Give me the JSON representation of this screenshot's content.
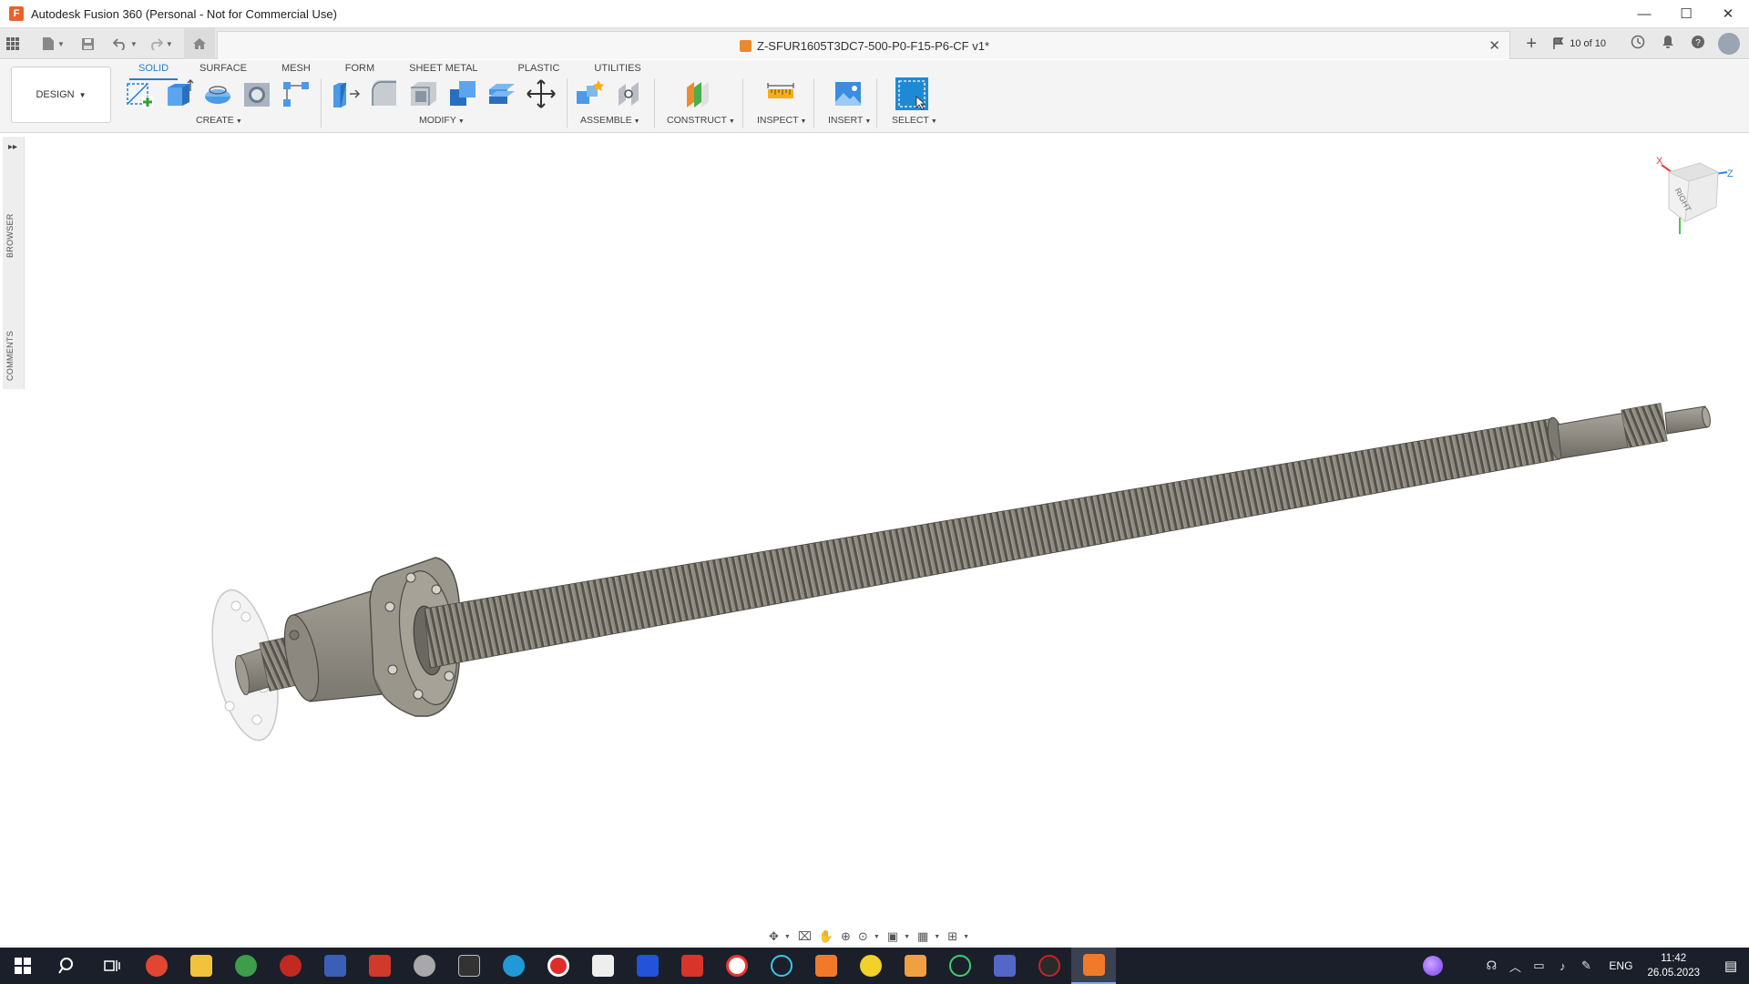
{
  "window": {
    "title": "Autodesk Fusion 360 (Personal - Not for Commercial Use)",
    "app_icon_letter": "F",
    "controls": [
      "—",
      "☐",
      "✕"
    ]
  },
  "quickaccess": {
    "icons": [
      "grid-icon",
      "file-icon",
      "save-icon",
      "undo-icon",
      "redo-icon",
      "home-icon"
    ],
    "document_title": "Z-SFUR1605T3DC7-500-P0-F15-P6-CF v1*",
    "tab_close": "✕",
    "new_tab": "+",
    "jobs": "10 of 10"
  },
  "ribbon": {
    "workspace": "DESIGN",
    "tabs": [
      "SOLID",
      "SURFACE",
      "MESH",
      "FORM",
      "SHEET METAL",
      "PLASTIC",
      "UTILITIES"
    ],
    "active_tab": "SOLID",
    "groups": [
      "CREATE",
      "MODIFY",
      "ASSEMBLE",
      "CONSTRUCT",
      "INSPECT",
      "INSERT",
      "SELECT"
    ]
  },
  "browser_strip": {
    "browser_label": "BROWSER",
    "comments_label": "COMMENTS",
    "expand": "▸▸"
  },
  "viewcube": {
    "face_label": "RIGHT",
    "axis_x": "X",
    "axis_z": "Z",
    "colors": {
      "x": "#e2413b",
      "y": "#53c24d",
      "z": "#2f86e0"
    }
  },
  "taskbar": {
    "language": "ENG",
    "time": "11:42",
    "date": "26.05.2023"
  },
  "colors": {
    "accent": "#1e7ed6",
    "screw": "#8e8a80",
    "screw_dark": "#5f5c55"
  }
}
